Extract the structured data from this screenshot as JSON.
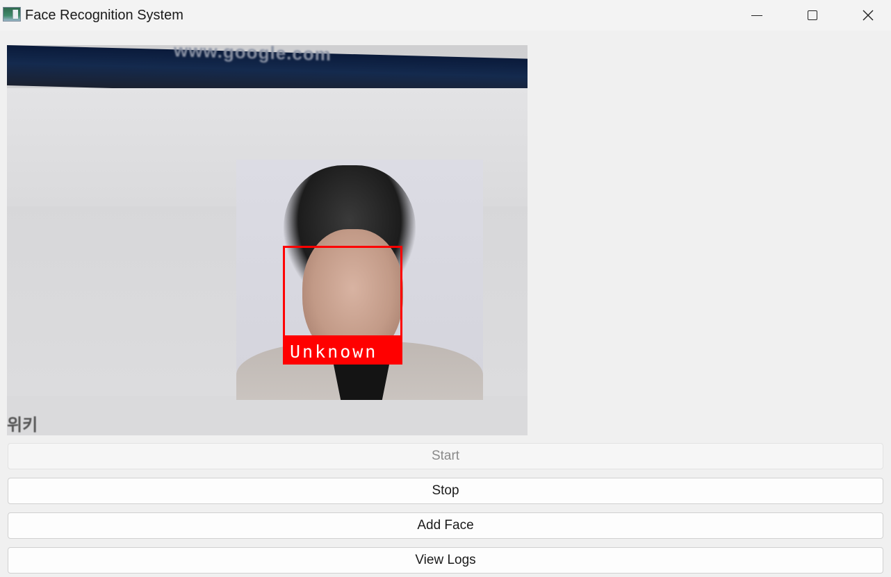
{
  "window": {
    "title": "Face Recognition System"
  },
  "camera": {
    "detection_label": "Unknown",
    "box_color": "#ff0000",
    "background_text_url": "www.google.com",
    "background_text_korean": "위키"
  },
  "buttons": {
    "start": {
      "label": "Start",
      "enabled": false
    },
    "stop": {
      "label": "Stop",
      "enabled": true
    },
    "add_face": {
      "label": "Add Face",
      "enabled": true
    },
    "view_logs": {
      "label": "View Logs",
      "enabled": true
    }
  },
  "icons": {
    "app": "app-icon",
    "minimize": "minimize-icon",
    "maximize": "maximize-icon",
    "close": "close-icon"
  }
}
